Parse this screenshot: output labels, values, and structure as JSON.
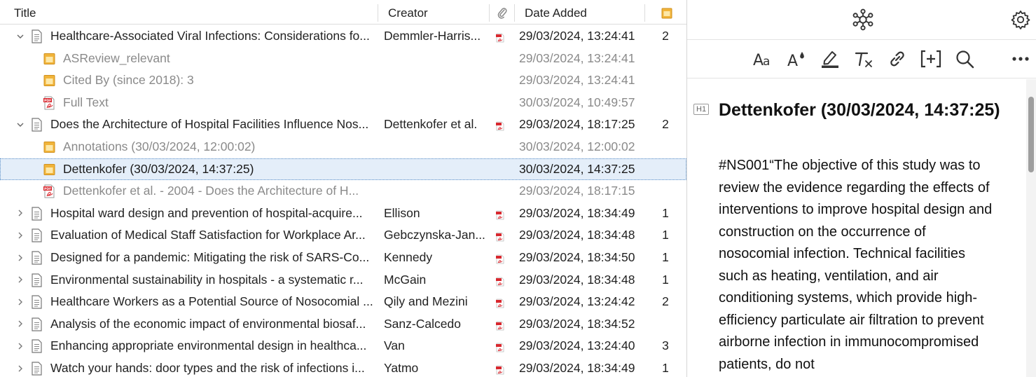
{
  "columns": {
    "title": "Title",
    "creator": "Creator",
    "date_added": "Date Added"
  },
  "rows": [
    {
      "kind": "item",
      "expanded": true,
      "icon": "document-icon",
      "title": "Healthcare-Associated Viral Infections: Considerations fo...",
      "creator": "Demmler-Harris...",
      "has_pdf": true,
      "date": "29/03/2024, 13:24:41",
      "notes": "2"
    },
    {
      "kind": "child",
      "icon": "note-icon",
      "title": "ASReview_relevant",
      "date": "29/03/2024, 13:24:41"
    },
    {
      "kind": "child",
      "icon": "note-icon",
      "title": "Cited By (since 2018): 3",
      "date": "29/03/2024, 13:24:41"
    },
    {
      "kind": "child",
      "icon": "pdf-icon",
      "title": "Full Text",
      "date": "30/03/2024, 10:49:57"
    },
    {
      "kind": "item",
      "expanded": true,
      "icon": "document-icon",
      "title": "Does the Architecture of Hospital Facilities Influence Nos...",
      "creator": "Dettenkofer et al.",
      "has_pdf": true,
      "date": "29/03/2024, 18:17:25",
      "notes": "2"
    },
    {
      "kind": "child",
      "icon": "note-icon",
      "title": "Annotations (30/03/2024, 12:00:02)",
      "date": "30/03/2024, 12:00:02"
    },
    {
      "kind": "child",
      "icon": "note-icon",
      "title": "Dettenkofer (30/03/2024, 14:37:25)",
      "date": "30/03/2024, 14:37:25",
      "selected": true
    },
    {
      "kind": "child",
      "icon": "pdf-icon",
      "title": "Dettenkofer et al. - 2004 - Does the Architecture of H...",
      "date": "29/03/2024, 18:17:15"
    },
    {
      "kind": "item",
      "expanded": false,
      "icon": "document-icon",
      "title": "Hospital ward design and prevention of hospital-acquire...",
      "creator": "Ellison",
      "has_pdf": true,
      "date": "29/03/2024, 18:34:49",
      "notes": "1"
    },
    {
      "kind": "item",
      "expanded": false,
      "icon": "document-icon",
      "title": "Evaluation of Medical Staff Satisfaction for Workplace Ar...",
      "creator": "Gebczynska-Jan...",
      "has_pdf": true,
      "date": "29/03/2024, 18:34:48",
      "notes": "1"
    },
    {
      "kind": "item",
      "expanded": false,
      "icon": "document-icon",
      "title": "Designed for a pandemic: Mitigating the risk of SARS-Co...",
      "creator": "Kennedy",
      "has_pdf": true,
      "date": "29/03/2024, 18:34:50",
      "notes": "1"
    },
    {
      "kind": "item",
      "expanded": false,
      "icon": "document-icon",
      "title": "Environmental sustainability in hospitals - a systematic r...",
      "creator": "McGain",
      "has_pdf": true,
      "date": "29/03/2024, 18:34:48",
      "notes": "1"
    },
    {
      "kind": "item",
      "expanded": false,
      "icon": "document-icon",
      "title": "Healthcare Workers as a Potential Source of Nosocomial ...",
      "creator": "Qily and Mezini",
      "has_pdf": true,
      "date": "29/03/2024, 13:24:42",
      "notes": "2"
    },
    {
      "kind": "item",
      "expanded": false,
      "icon": "document-icon",
      "title": "Analysis of the economic impact of environmental biosaf...",
      "creator": "Sanz-Calcedo",
      "has_pdf": true,
      "date": "29/03/2024, 18:34:52",
      "notes": ""
    },
    {
      "kind": "item",
      "expanded": false,
      "icon": "document-icon",
      "title": "Enhancing appropriate environmental design in healthca...",
      "creator": "Van",
      "has_pdf": true,
      "date": "29/03/2024, 13:24:40",
      "notes": "3"
    },
    {
      "kind": "item",
      "expanded": false,
      "icon": "document-icon",
      "title": "Watch your hands: door types and the risk of infections i...",
      "creator": "Yatmo",
      "has_pdf": true,
      "date": "29/03/2024, 18:34:49",
      "notes": "1"
    }
  ],
  "note": {
    "heading_badge": "H1",
    "heading": "Dettenkofer (30/03/2024, 14:37:25)",
    "paragraph": "#NS001“The objective of this study was to review the evidence regarding the effects of interventions to improve hospital design and construction on the occurrence of nosocomial infection. Technical facilities such as heating, ventilation, and air conditioning systems, which provide high-efficiency particulate air filtration to prevent airborne infection in immunocompromised patients, do not"
  },
  "toolbar_icons": [
    "text-format-icon",
    "text-color-icon",
    "highlight-icon",
    "clear-formatting-icon",
    "insert-link-icon",
    "insert-citation-icon",
    "find-replace-icon",
    "more-icon"
  ],
  "colors": {
    "selection_bg": "#e4eef9",
    "note_icon": "#f1b43a",
    "pdf_icon": "#d9272e"
  }
}
